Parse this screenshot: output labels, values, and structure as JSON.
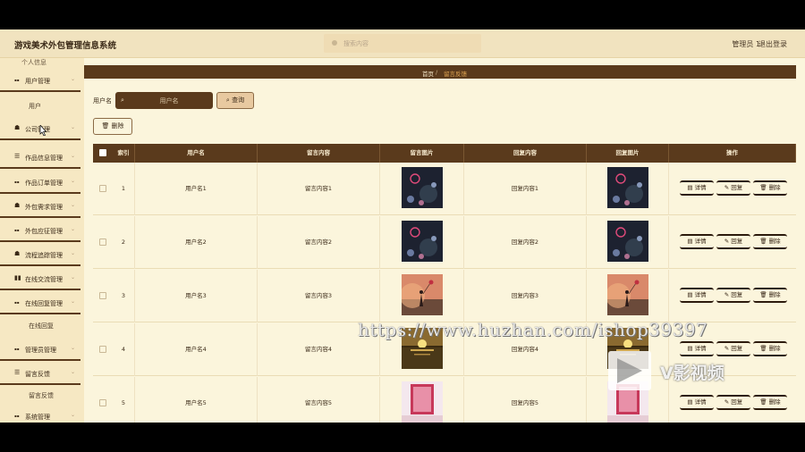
{
  "header": {
    "title": "游戏美术外包管理信息系统",
    "search_placeholder": "搜索内容",
    "user": "管理员 1",
    "logout": "退出登录"
  },
  "sidebar": {
    "top_item": "个人信息",
    "items": [
      {
        "icon": "grid-icon",
        "label": "用户管理"
      },
      {
        "sub": "用户"
      },
      {
        "icon": "cup-icon",
        "label": "公司管理"
      },
      {
        "icon": "list-icon",
        "label": "作品信息管理"
      },
      {
        "icon": "grid-icon",
        "label": "作品订单管理"
      },
      {
        "icon": "cup-icon",
        "label": "外包需求管理"
      },
      {
        "icon": "grid-icon",
        "label": "外包应征管理"
      },
      {
        "icon": "cup-icon",
        "label": "流程追踪管理"
      },
      {
        "icon": "bar-chart-icon",
        "label": "在线交流管理"
      },
      {
        "icon": "grid-icon",
        "label": "在线回复管理"
      },
      {
        "sub": "在线回复"
      },
      {
        "icon": "grid-icon",
        "label": "管理员管理"
      },
      {
        "icon": "list-icon",
        "label": "留言反馈"
      },
      {
        "sub": "留言反馈"
      },
      {
        "icon": "grid-icon",
        "label": "系统管理"
      }
    ]
  },
  "breadcrumb": {
    "home": "首页",
    "separator": "/",
    "current": "留言反馈"
  },
  "filter": {
    "label": "用户名",
    "placeholder": "用户名",
    "query_label": "查询",
    "delete_label": "删除"
  },
  "table": {
    "headers": [
      "索引",
      "用户名",
      "留言内容",
      "留言图片",
      "回复内容",
      "回复图片",
      "操作"
    ],
    "actions": {
      "detail": "详情",
      "reply": "回复",
      "delete": "删除"
    },
    "rows": [
      {
        "index": "1",
        "user": "用户名1",
        "content": "留言内容1",
        "reply": "回复内容1",
        "image": "dark-moon"
      },
      {
        "index": "2",
        "user": "用户名2",
        "content": "留言内容2",
        "reply": "回复内容2",
        "image": "dark-moon"
      },
      {
        "index": "3",
        "user": "用户名3",
        "content": "留言内容3",
        "reply": "回复内容3",
        "image": "girl-balloon"
      },
      {
        "index": "4",
        "user": "用户名4",
        "content": "留言内容4",
        "reply": "回复内容4",
        "image": "sunset-sea"
      },
      {
        "index": "5",
        "user": "用户名5",
        "content": "留言内容5",
        "reply": "回复内容5",
        "image": "pink-frame"
      }
    ]
  },
  "overlay": {
    "watermark": "https://www.huzhan.com/ishop39397",
    "brand": "V影视频"
  },
  "colors": {
    "accent": "#5a3a1c",
    "background": "#fbf5dc",
    "sidebar": "#f6e8c3"
  }
}
